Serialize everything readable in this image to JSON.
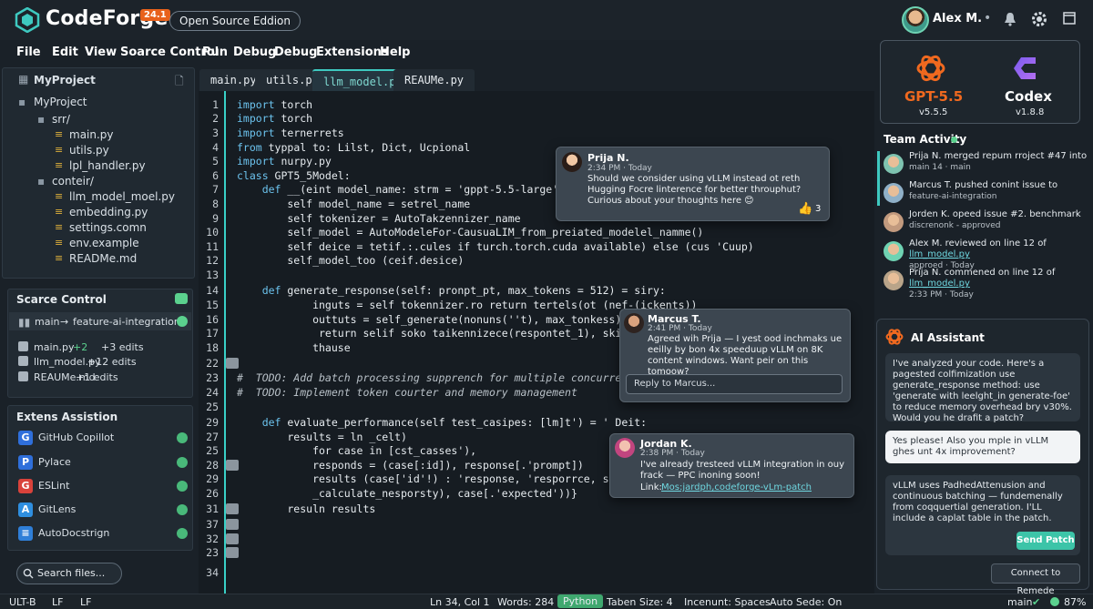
{
  "app": {
    "title": "CodeForge",
    "version": "24.1",
    "edition": "Open Source Eddion"
  },
  "user": {
    "name": "Alex M."
  },
  "menu": [
    "File",
    "Edit",
    "View",
    "Soarce Control",
    "Pun",
    "Debug",
    "Debug",
    "Extensions",
    "Help"
  ],
  "explorer": {
    "header": "MyProject",
    "root": "MyProject",
    "items": [
      {
        "label": "srr/",
        "type": "folder"
      },
      {
        "label": "main.py",
        "type": "file"
      },
      {
        "label": "utils.py",
        "type": "file"
      },
      {
        "label": "lpl_handler.py",
        "type": "file"
      },
      {
        "label": "conteir/",
        "type": "folder"
      },
      {
        "label": "llm_model_moel.py",
        "type": "file"
      },
      {
        "label": "embedding.py",
        "type": "file"
      },
      {
        "label": "settings.comn",
        "type": "file"
      },
      {
        "label": "env.example",
        "type": "file"
      },
      {
        "label": "READMe.md",
        "type": "file"
      }
    ]
  },
  "source_control": {
    "title": "Scarce Control",
    "branch": "main",
    "arrow": "→",
    "target": "feature-ai-integration",
    "changes": [
      {
        "file": "main.py",
        "plus": "+2",
        "edits": "+3 edits"
      },
      {
        "file": "llm_model.py",
        "plus": "",
        "edits": "+12 edits"
      },
      {
        "file": "REAUMe.md",
        "plus": "",
        "edits": "+1 edits"
      }
    ]
  },
  "extensions": {
    "title": "Extens Assistion",
    "items": [
      {
        "name": "GitHub Copillot",
        "icon": "G",
        "color": "#2f6fdb"
      },
      {
        "name": "Pylace",
        "icon": "P",
        "color": "#2f6fdb"
      },
      {
        "name": "ESLint",
        "icon": "G",
        "color": "#d9423b"
      },
      {
        "name": "GitLens",
        "icon": "A",
        "color": "#2f8fe0"
      },
      {
        "name": "AutoDocstrign",
        "icon": "≡",
        "color": "#2f7fd8"
      }
    ]
  },
  "search": {
    "placeholder": "Search files..."
  },
  "tabs": [
    {
      "label": "main.py",
      "active": false
    },
    {
      "label": "utils.py",
      "active": false
    },
    {
      "label": "llm_model.py",
      "active": true
    },
    {
      "label": "REAUMe.py",
      "active": false
    }
  ],
  "code_lines": [
    {
      "n": "1",
      "t": "import torch"
    },
    {
      "n": "2",
      "t": "import torch"
    },
    {
      "n": "3",
      "t": "import ternerrets"
    },
    {
      "n": "4",
      "t": "from typpal to: Lilst, Dict, Ucpional"
    },
    {
      "n": "5",
      "t": "import nurpy.py"
    },
    {
      "n": "6",
      "t": "class GPT5_5Model:"
    },
    {
      "n": "7",
      "t": "    def __(eint model_name: strm = 'gppt-5.5-large')"
    },
    {
      "n": "8",
      "t": "        self model_name = setrel_name"
    },
    {
      "n": "9",
      "t": "        self tokenizer = AutoTakzennizer_name"
    },
    {
      "n": "10",
      "t": "        self_model = AutoModeleFor-CausuaLIM_from_preiated_modelel_namme()"
    },
    {
      "n": "11",
      "t": "        self deice = tetif.:.cules if turch.torch.cuda available) else (cus 'Cuup)"
    },
    {
      "n": "12",
      "t": "        self_model_too (ceif.desice)"
    },
    {
      "n": "13",
      "t": ""
    },
    {
      "n": "14",
      "t": "    def generate_response(self: pronpt_pt, max_tokens = 512) = siry:"
    },
    {
      "n": "15",
      "t": "            inguts = self tokennizer.ro return tertels(ot (nef-(ickents))"
    },
    {
      "n": "16",
      "t": "            outtuts = self_generate(nonuns(''t), max_tonkess))"
    },
    {
      "n": "17",
      "t": "             return selif soko taikennizece(respontet_1), skip_specialon"
    },
    {
      "n": "18",
      "t": "            thause"
    },
    {
      "n": "22",
      "t": ""
    },
    {
      "n": "23",
      "t": "#  TODO: Add batch processing supprench for multiple concurrent requests"
    },
    {
      "n": "24",
      "t": "#  TODO: Implement token courter and memory management"
    },
    {
      "n": "25",
      "t": ""
    },
    {
      "n": "29",
      "t": "    def evaluate_performance(self test_casipes: [lm]t') = ' Deit:"
    },
    {
      "n": "27",
      "t": "        results = ln _celt)"
    },
    {
      "n": "25",
      "t": "            for case in [cst_casses'),"
    },
    {
      "n": "28",
      "t": "            responds = (case[:id]), response[.'prompt])"
    },
    {
      "n": "29",
      "t": "            results (case['id'!) : 'response, 'resporrce, self',"
    },
    {
      "n": "26",
      "t": "            _calculate_nesporsty), case[.'expected'))}"
    },
    {
      "n": "31",
      "t": "        resuln results"
    },
    {
      "n": "37",
      "t": ""
    },
    {
      "n": "32",
      "t": ""
    },
    {
      "n": "23",
      "t": ""
    },
    {
      "n": "34",
      "t": ""
    }
  ],
  "comments": [
    {
      "name": "Prija N.",
      "time": "2:34 PM · Today",
      "text": "Should we consider using vLLM instead ot reth Hugging Focre linterence for better throuphut? Curious about your thoughts here 😊",
      "likes": "3"
    },
    {
      "name": "Marcus T.",
      "time": "2:41 PM · Today",
      "text": "Agreed wih Prija — I yest ood inchmaks ue eeilly by bon 4x speeduup vLLM on 8K content windows. Want peir on this tomoow?",
      "reply": "Reply to Marcus..."
    },
    {
      "name": "Jordan K.",
      "time": "2:38 PM · Today",
      "text": "I've already tresteed vLLM integration in ouy frack — PPC inoning soon!",
      "link_label": "Link:",
      "link": "Mos:jardph,codeforge-vLm-patch"
    }
  ],
  "models": [
    {
      "name": "GPT-5.5",
      "version": "v5.5.5",
      "color": "#f0691f"
    },
    {
      "name": "Codex",
      "version": "v1.8.8",
      "color": "#ffffff"
    }
  ],
  "activity": {
    "title": "Team Activity",
    "items": [
      {
        "text": "Prija N. merged repum rroject #47 into",
        "sub": "main 14 · main"
      },
      {
        "text": "Marcus T. pushed conint issue to",
        "sub": "feature-ai-integration"
      },
      {
        "text": "Jorden K. opeed issue #2. benchmark",
        "sub": "discrenonk - approved"
      },
      {
        "text": "Alex M. reviewed on line 12 of",
        "link": "llm_model.py",
        "sub": "approed · Today"
      },
      {
        "text": "Prija N. commened on line 12 of",
        "link": "llm_model.py",
        "sub": "2:33 PM · Today"
      }
    ]
  },
  "assistant": {
    "title": "AI Assistant",
    "msg1": "I've analyzed your code. Here's a pagested colfimization use generate_response method: use 'generate with leelght_in generate-foe' to reduce memory overhead bry v30%. Would you he drafit a patch?",
    "msg2": "Yes please! Also you mple in vLLM ghes unt 4x improvement?",
    "msg3": "vLLM uses PadhedAttenusion and continuous batching — fundemenally from coqquertial generation. I'LL include a caplat table in the patch.",
    "send_label": "Send Patch",
    "connect_label": "Connect to Remede"
  },
  "status": {
    "left1": "ULT-B",
    "left2": "LF",
    "left3": "LF",
    "position": "Ln 34, Col 1",
    "words": "Words: 284",
    "language": "Python",
    "tab_size": "Taben Size:  4",
    "indent": "Incenunt:  Spaces",
    "autosave": "Auto Sede: On",
    "branch": "main",
    "battery": "87%"
  }
}
